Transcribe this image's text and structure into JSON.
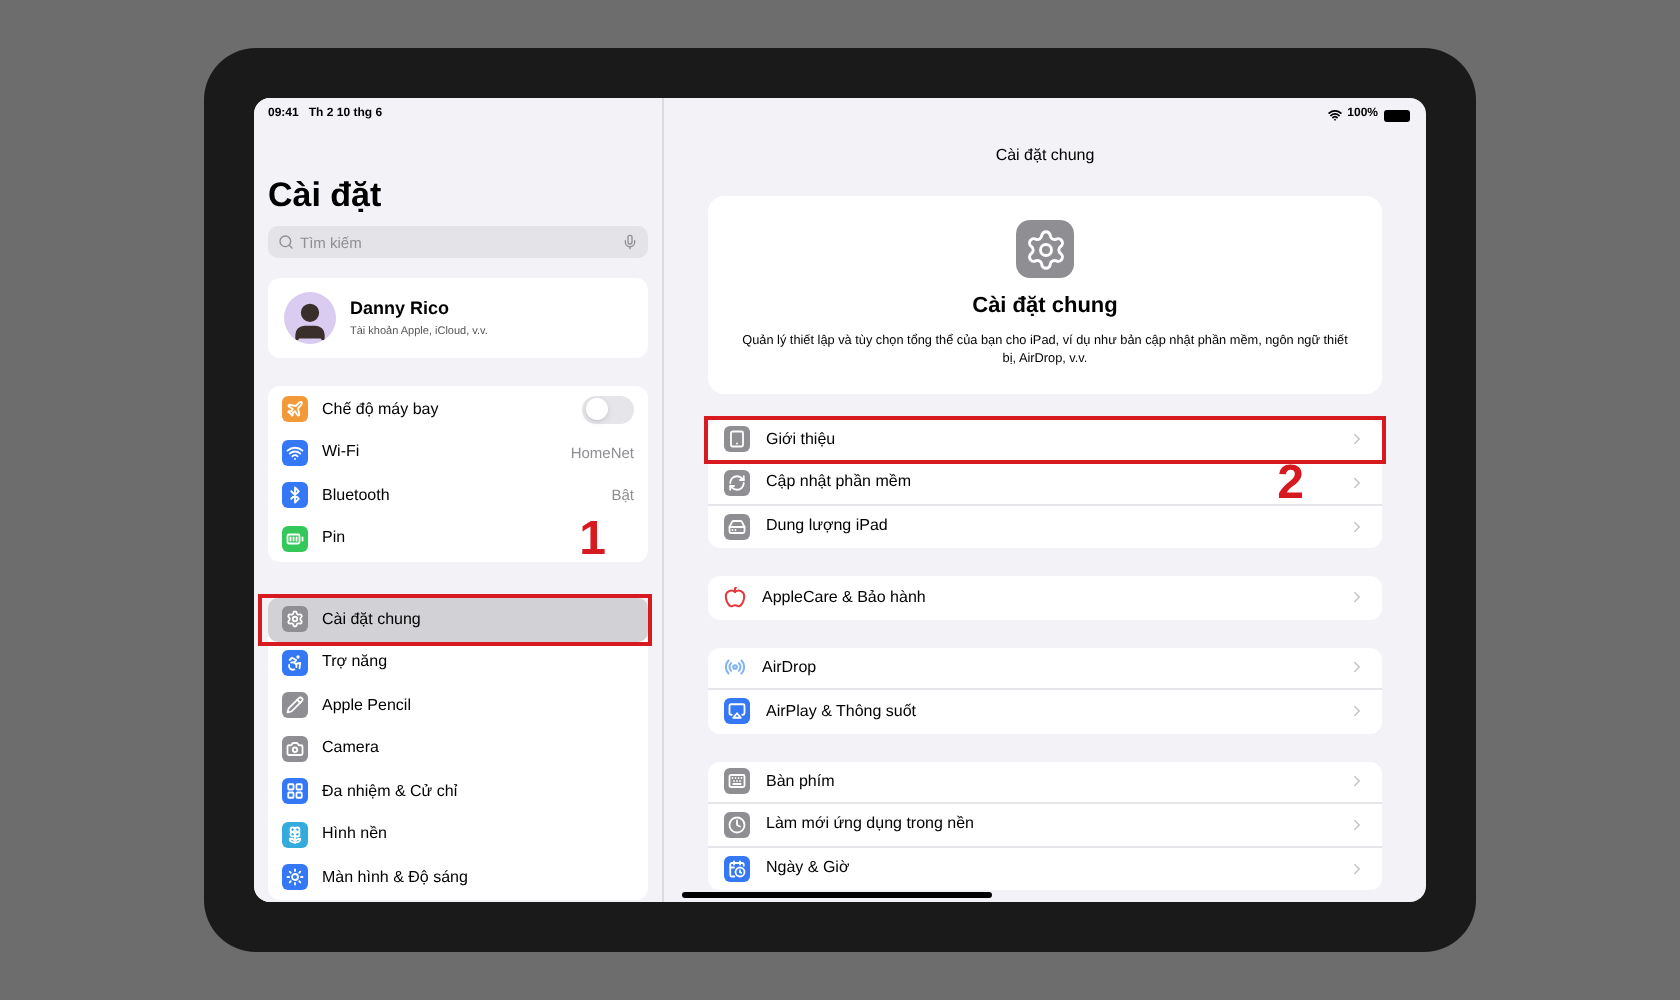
{
  "status_bar": {
    "time": "09:41",
    "date": "Th 2 10 thg 6",
    "battery": "100%"
  },
  "sidebar": {
    "title": "Cài đặt",
    "search": {
      "placeholder": "Tìm kiếm"
    },
    "profile": {
      "name": "Danny Rico",
      "subtitle": "Tài khoản Apple, iCloud, v.v."
    },
    "groups": [
      [
        {
          "kind": "toggle",
          "label": "Chế độ máy bay",
          "on": false,
          "selected": false,
          "color": "#f19a37"
        },
        {
          "kind": "value",
          "label": "Wi-Fi",
          "value": "HomeNet",
          "selected": false,
          "color": "#3478f6"
        },
        {
          "kind": "value",
          "label": "Bluetooth",
          "value": "Bật",
          "selected": false,
          "color": "#3478f6"
        },
        {
          "kind": "plain",
          "label": "Pin",
          "selected": false,
          "color": "#34c759"
        }
      ],
      [
        {
          "kind": "plain",
          "label": "Cài đặt chung",
          "selected": true,
          "color": "#8e8e93",
          "callout": "1"
        },
        {
          "kind": "plain",
          "label": "Trợ năng",
          "selected": false,
          "color": "#3478f6"
        },
        {
          "kind": "plain",
          "label": "Apple Pencil",
          "selected": false,
          "color": "#8e8e93"
        },
        {
          "kind": "plain",
          "label": "Camera",
          "selected": false,
          "color": "#8e8e93"
        },
        {
          "kind": "plain",
          "label": "Đa nhiệm & Cử chỉ",
          "selected": false,
          "color": "#3478f6"
        },
        {
          "kind": "plain",
          "label": "Hình nền",
          "selected": false,
          "color": "#35aadc"
        },
        {
          "kind": "plain",
          "label": "Màn hình & Độ sáng",
          "selected": false,
          "color": "#3478f6"
        }
      ]
    ]
  },
  "detail": {
    "nav_title": "Cài đặt chung",
    "header": {
      "title": "Cài đặt chung",
      "description": "Quản lý thiết lập và tùy chọn tổng thể của bạn cho iPad, ví dụ như bản cập nhật phần mềm, ngôn ngữ thiết bị, AirDrop, v.v."
    },
    "groups": [
      [
        {
          "label": "Giới thiệu",
          "color": "#8e8e93",
          "callout": "2"
        },
        {
          "label": "Cập nhật phần mềm",
          "color": "#8e8e93"
        },
        {
          "label": "Dung lượng iPad",
          "color": "#8e8e93"
        }
      ],
      [
        {
          "label": "AppleCare & Bảo hành",
          "color": "#e5383b"
        }
      ],
      [
        {
          "label": "AirDrop",
          "color": "#7fb3f5"
        },
        {
          "label": "AirPlay & Thông suốt",
          "color": "#3478f6"
        }
      ],
      [
        {
          "label": "Bàn phím",
          "color": "#8e8e93"
        },
        {
          "label": "Làm mới ứng dụng trong nền",
          "color": "#8e8e93"
        },
        {
          "label": "Ngày & Giờ",
          "color": "#3478f6"
        }
      ]
    ]
  }
}
